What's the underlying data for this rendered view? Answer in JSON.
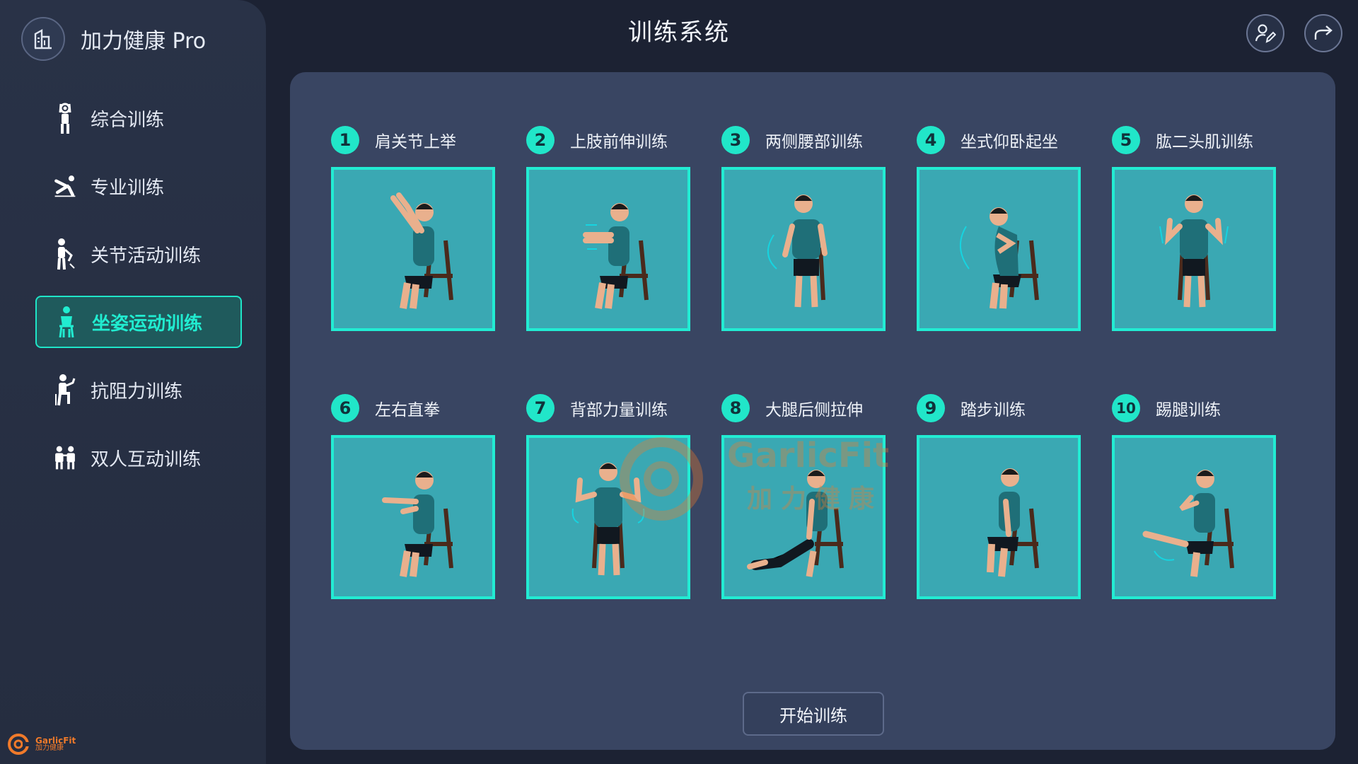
{
  "app": {
    "title": "加力健康 Pro"
  },
  "header": {
    "title": "训练系统"
  },
  "sidebar": {
    "items": [
      {
        "label": "综合训练",
        "icon": "person-arms-up-icon"
      },
      {
        "label": "专业训练",
        "icon": "person-pushup-icon"
      },
      {
        "label": "关节活动训练",
        "icon": "person-joint-icon"
      },
      {
        "label": "坐姿运动训练",
        "icon": "person-seated-icon",
        "active": true
      },
      {
        "label": "抗阻力训练",
        "icon": "person-resistance-icon"
      },
      {
        "label": "双人互动训练",
        "icon": "two-people-icon"
      }
    ]
  },
  "exercises": [
    {
      "num": "1",
      "title": "肩关节上举"
    },
    {
      "num": "2",
      "title": "上肢前伸训练"
    },
    {
      "num": "3",
      "title": "两侧腰部训练"
    },
    {
      "num": "4",
      "title": "坐式仰卧起坐"
    },
    {
      "num": "5",
      "title": "肱二头肌训练"
    },
    {
      "num": "6",
      "title": "左右直拳"
    },
    {
      "num": "7",
      "title": "背部力量训练"
    },
    {
      "num": "8",
      "title": "大腿后侧拉伸"
    },
    {
      "num": "9",
      "title": "踏步训练"
    },
    {
      "num": "10",
      "title": "踢腿训练"
    }
  ],
  "actions": {
    "start_label": "开始训练"
  },
  "brand": {
    "en": "GarlicFit",
    "cn": "加力健康"
  },
  "colors": {
    "accent": "#21e6c9",
    "panel": "#394562",
    "card": "#3aa8b3",
    "brand_orange": "#f07a2a"
  }
}
